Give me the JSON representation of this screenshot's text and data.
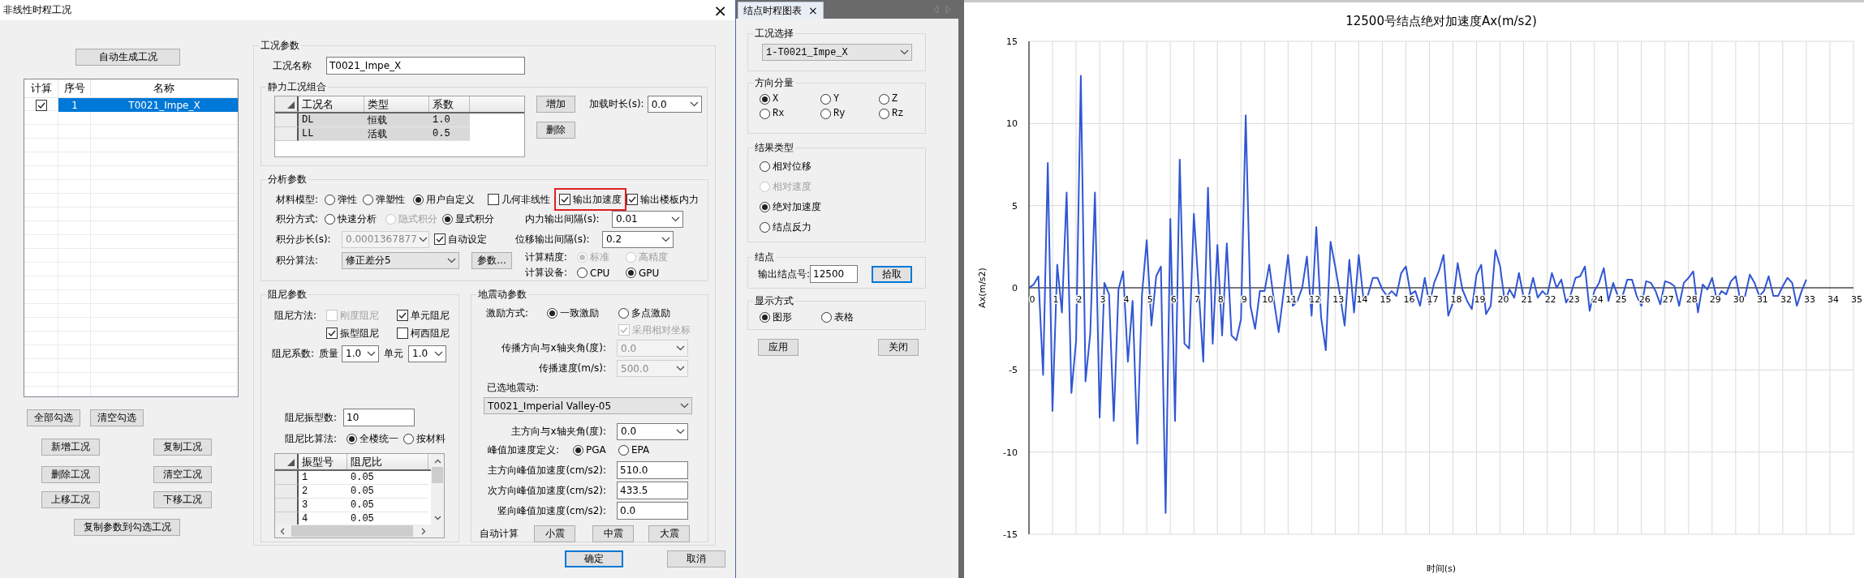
{
  "dialog": {
    "title": "非线性时程工况",
    "close_glyph": "×",
    "auto_generate_button": "自动生成工况",
    "case_list": {
      "columns": [
        "计算",
        "序号",
        "名称"
      ],
      "rows": [
        {
          "checked": true,
          "number": "1",
          "name": "T0021_Impe_X",
          "selected": true
        }
      ]
    },
    "case_buttons": [
      [
        "全部勾选",
        "清空勾选"
      ],
      [
        "新增工况",
        "复制工况"
      ],
      [
        "删除工况",
        "清空工况"
      ],
      [
        "上移工况",
        "下移工况"
      ],
      [
        "复制参数到勾选工况"
      ]
    ],
    "case_params": {
      "title": "工况参数",
      "name_label": "工况名称",
      "name_value": "T0021_Impe_X",
      "static_combo": {
        "title": "静力工况组合",
        "columns": [
          "工况名",
          "类型",
          "系数"
        ],
        "rows": [
          [
            "DL",
            "恒载",
            "1.0"
          ],
          [
            "LL",
            "活载",
            "0.5"
          ]
        ],
        "buttons": [
          "增加",
          "删除"
        ],
        "duration_label": "加载时长(s):",
        "duration_value": "0.0"
      },
      "analysis": {
        "title": "分析参数",
        "material": {
          "label": "材料模型:",
          "options": [
            {
              "label": "弹性",
              "selected": false
            },
            {
              "label": "弹塑性",
              "selected": false
            },
            {
              "label": "用户自定义",
              "selected": true
            }
          ]
        },
        "outputs": [
          {
            "label": "几何非线性",
            "checked": false,
            "highlighted": false
          },
          {
            "label": "输出加速度",
            "checked": true,
            "highlighted": true
          },
          {
            "label": "输出楼板内力",
            "checked": true,
            "highlighted": false
          }
        ],
        "integration": {
          "label": "积分方式:",
          "options": [
            {
              "label": "快速分析",
              "selected": false,
              "disabled": false
            },
            {
              "label": "隐式积分",
              "selected": false,
              "disabled": true
            },
            {
              "label": "显式积分",
              "selected": true,
              "disabled": false
            }
          ]
        },
        "force_interval": {
          "label": "内力输出间隔(s):",
          "value": "0.01"
        },
        "step": {
          "label": "积分步长(s):",
          "value": "0.0001367877",
          "disabled": true
        },
        "auto_set": {
          "label": "自动设定",
          "checked": true
        },
        "disp_interval": {
          "label": "位移输出间隔(s):",
          "value": "0.2"
        },
        "algorithm": {
          "label": "积分算法:",
          "value": "修正差分5"
        },
        "params_button": "参数...",
        "precision": {
          "label": "计算精度:",
          "options": [
            {
              "label": "标准",
              "selected": true,
              "disabled": true
            },
            {
              "label": "高精度",
              "selected": false,
              "disabled": true
            }
          ]
        },
        "device": {
          "label": "计算设备:",
          "options": [
            {
              "label": "CPU",
              "selected": false,
              "disabled": false
            },
            {
              "label": "GPU",
              "selected": true,
              "disabled": false
            }
          ]
        }
      },
      "damping": {
        "title": "阻尼参数",
        "method_label": "阻尼方法:",
        "methods": [
          {
            "label": "刚度阻尼",
            "checked": false,
            "disabled": true
          },
          {
            "label": "单元阻尼",
            "checked": true,
            "disabled": false
          },
          {
            "label": "振型阻尼",
            "checked": true,
            "disabled": false
          },
          {
            "label": "柯西阻尼",
            "checked": false,
            "disabled": false
          }
        ],
        "coef_label": "阻尼系数:",
        "mass_label": "质量",
        "mass_value": "1.0",
        "element_label": "单元",
        "element_value": "1.0",
        "modes_label": "阻尼振型数:",
        "modes_value": "10",
        "ratio": {
          "label": "阻尼比算法:",
          "options": [
            {
              "label": "全楼统一",
              "selected": true
            },
            {
              "label": "按材料",
              "selected": false
            }
          ]
        },
        "table": {
          "columns": [
            "振型号",
            "阻尼比"
          ],
          "rows": [
            [
              "1",
              "0.05"
            ],
            [
              "2",
              "0.05"
            ],
            [
              "3",
              "0.05"
            ],
            [
              "4",
              "0.05"
            ]
          ]
        }
      },
      "ground_motion": {
        "title": "地震动参数",
        "excitation": {
          "label": "激励方式:",
          "options": [
            {
              "label": "一致激励",
              "selected": true
            },
            {
              "label": "多点激励",
              "selected": false
            }
          ]
        },
        "relative_coords": {
          "label": "采用相对坐标",
          "checked": true,
          "disabled": true
        },
        "propagation": [
          {
            "label": "传播方向与x轴夹角(度):",
            "value": "0.0",
            "disabled": true
          },
          {
            "label": "传播速度(m/s):",
            "value": "500.0",
            "disabled": true
          }
        ],
        "selected_label": "已选地震动:",
        "selected_value": "T0021_Imperial Valley-05",
        "angle": {
          "label": "主方向与x轴夹角(度):",
          "value": "0.0"
        },
        "peak_def": {
          "label": "峰值加速度定义:",
          "options": [
            {
              "label": "PGA",
              "selected": true
            },
            {
              "label": "EPA",
              "selected": false
            }
          ]
        },
        "peaks": [
          {
            "label": "主方向峰值加速度(cm/s2):",
            "value": "510.0"
          },
          {
            "label": "次方向峰值加速度(cm/s2):",
            "value": "433.5"
          },
          {
            "label": "竖向峰值加速度(cm/s2):",
            "value": "0.0"
          }
        ],
        "auto_label": "自动计算",
        "auto_buttons": [
          "小震",
          "中震",
          "大震"
        ]
      }
    },
    "footer_buttons": [
      {
        "label": "确定",
        "default": true
      },
      {
        "label": "取消",
        "default": false
      }
    ]
  },
  "node_panel": {
    "tab": "结点时程图表",
    "tab_close": "×",
    "case": {
      "title": "工况选择",
      "value": "1-T0021_Impe_X"
    },
    "direction": {
      "title": "方向分量",
      "options": [
        {
          "label": "X",
          "selected": true
        },
        {
          "label": "Y",
          "selected": false
        },
        {
          "label": "Z",
          "selected": false
        },
        {
          "label": "Rx",
          "selected": false
        },
        {
          "label": "Ry",
          "selected": false
        },
        {
          "label": "Rz",
          "selected": false
        }
      ]
    },
    "result_type": {
      "title": "结果类型",
      "options": [
        {
          "label": "相对位移",
          "selected": false,
          "disabled": false
        },
        {
          "label": "相对速度",
          "selected": false,
          "disabled": true
        },
        {
          "label": "绝对加速度",
          "selected": true,
          "disabled": false
        },
        {
          "label": "结点反力",
          "selected": false,
          "disabled": false
        }
      ]
    },
    "node": {
      "title": "结点",
      "label": "输出结点号:",
      "value": "12500",
      "pick_button": "拾取"
    },
    "display": {
      "title": "显示方式",
      "options": [
        {
          "label": "图形",
          "selected": true
        },
        {
          "label": "表格",
          "selected": false
        }
      ]
    },
    "buttons": [
      "应用",
      "关闭"
    ]
  },
  "chart": {
    "chart_data": {
      "type": "line",
      "title": "12500号结点绝对加速度Ax(m/s2)",
      "xlabel": "时间(s)",
      "ylabel": "Ax(m/s2)",
      "x": [
        0,
        0.2,
        0.4,
        0.6,
        0.8,
        1,
        1.2,
        1.4,
        1.6,
        1.8,
        2,
        2.2,
        2.4,
        2.6,
        2.8,
        3,
        3.2,
        3.4,
        3.6,
        3.8,
        4,
        4.2,
        4.4,
        4.6,
        4.8,
        5,
        5.2,
        5.4,
        5.6,
        5.8,
        6,
        6.2,
        6.4,
        6.6,
        6.8,
        7,
        7.2,
        7.4,
        7.6,
        7.8,
        8,
        8.2,
        8.4,
        8.6,
        8.8,
        9,
        9.2,
        9.4,
        9.6,
        9.8,
        10,
        10.2,
        10.4,
        10.6,
        10.8,
        11,
        11.2,
        11.4,
        11.6,
        11.8,
        12,
        12.2,
        12.4,
        12.6,
        12.8,
        13,
        13.2,
        13.4,
        13.6,
        13.8,
        14,
        14.2,
        14.4,
        14.6,
        14.8,
        15,
        15.2,
        15.4,
        15.6,
        15.8,
        16,
        16.2,
        16.4,
        16.6,
        16.8,
        17,
        17.2,
        17.4,
        17.6,
        17.8,
        18,
        18.2,
        18.4,
        18.6,
        18.8,
        19,
        19.2,
        19.4,
        19.6,
        19.8,
        20,
        20.2,
        20.4,
        20.6,
        20.8,
        21,
        21.2,
        21.4,
        21.6,
        21.8,
        22,
        22.2,
        22.4,
        22.6,
        22.8,
        23,
        23.2,
        23.4,
        23.6,
        23.8,
        24,
        24.2,
        24.4,
        24.6,
        24.8,
        25,
        25.2,
        25.4,
        25.6,
        25.8,
        26,
        26.2,
        26.4,
        26.6,
        26.8,
        27,
        27.2,
        27.4,
        27.6,
        27.8,
        28,
        28.2,
        28.4,
        28.6,
        28.8,
        29,
        29.2,
        29.4,
        29.6,
        29.8,
        30,
        30.2,
        30.4,
        30.6,
        30.8,
        31,
        31.2,
        31.4,
        31.6,
        31.8,
        32,
        32.2,
        32.4,
        32.6,
        32.8,
        33
      ],
      "values": [
        0,
        0.2,
        0.7,
        -5.3,
        7.6,
        -7.5,
        1.4,
        -1.5,
        5.8,
        -6.4,
        -3.2,
        12.9,
        -5.7,
        -2.8,
        5.8,
        -7.9,
        0.3,
        -0.4,
        -8.1,
        -0.1,
        1.0,
        -4.5,
        -0.8,
        -9.5,
        -0.4,
        2.9,
        -2.3,
        0.7,
        1.3,
        -13.7,
        4.2,
        -8.1,
        7.8,
        -3.4,
        -3.7,
        4.5,
        0,
        -4.5,
        6.1,
        -3.4,
        2.6,
        -2.9,
        2.7,
        -2.9,
        -3.2,
        -1.9,
        10.5,
        -1.1,
        -2.5,
        -0.2,
        -0.2,
        1.4,
        -0.8,
        -2.7,
        -0.4,
        2.0,
        -1.1,
        -0.8,
        0,
        1.9,
        -1.7,
        3.7,
        -1.8,
        -3.8,
        2.8,
        1.3,
        -0.4,
        -2.3,
        1.7,
        -1.5,
        2.0,
        -0.7,
        -0.4,
        0.6,
        0.6,
        -0.1,
        -0.5,
        -0.2,
        -0.5,
        0.9,
        1.3,
        -0.4,
        -0.2,
        -1.1,
        0.6,
        -1.0,
        0.3,
        1.0,
        2.0,
        -1.7,
        -0.9,
        1.5,
        -0.1,
        -0.8,
        -1.3,
        0.8,
        1.4,
        -1.6,
        -1.1,
        2.3,
        1.3,
        -0.9,
        -0.1,
        -0.6,
        0.9,
        -0.6,
        -0.6,
        0.6,
        -0.6,
        -0.2,
        -0.5,
        0.9,
        0,
        0.5,
        -0.9,
        -0.4,
        0.6,
        0.7,
        1.3,
        -1.4,
        -0.2,
        0.3,
        1.2,
        -0.8,
        0.3,
        -0.5,
        -0.5,
        0.5,
        0.5,
        -0.5,
        -1.1,
        0.4,
        0.3,
        -0.2,
        -1.0,
        0.4,
        0.3,
        0.1,
        -1.1,
        0.3,
        0.6,
        1.0,
        -1.5,
        0.2,
        -0.1,
        0.6,
        -0.7,
        -0.2,
        -0.4,
        0.4,
        0.7,
        -0.8,
        -0.5,
        0.8,
        0.3,
        -0.5,
        -0.2,
        0.7,
        -0.5,
        -0.5,
        0.1,
        0.6,
        0.3,
        -1.1,
        -0.2,
        0.5
      ],
      "xlim": [
        0,
        35
      ],
      "ylim": [
        -15,
        15
      ],
      "xticks": [
        0,
        1,
        2,
        3,
        4,
        5,
        6,
        7,
        8,
        9,
        10,
        11,
        12,
        13,
        14,
        15,
        16,
        17,
        18,
        19,
        20,
        21,
        22,
        23,
        24,
        25,
        26,
        27,
        28,
        29,
        30,
        31,
        32,
        33,
        34,
        35
      ],
      "yticks": [
        -15,
        -10,
        -5,
        0,
        5,
        10,
        15
      ],
      "grid": true
    }
  }
}
